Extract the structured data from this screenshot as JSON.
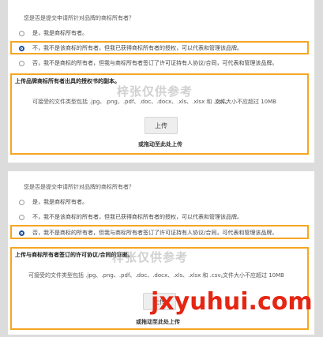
{
  "panel1": {
    "question": "您是否是提交申请所针对品牌的商标所有者？",
    "options": [
      "是，我是商标所有者。",
      "不，我不是该商标的所有者，但我已获得商标所有者的授权，可以代表和管理该品牌。",
      "否，我不是商标的所有者，但我与商标所有者签订了许可证持有人协议/合同，可代表和管理该品牌。"
    ],
    "selected_index": 1,
    "upload_title": "上传品牌商标所有者出具的授权书的副本。",
    "accept_text": "可接受的文件类型包括 .jpg、.png、.pdf、.doc、.docx、.xls、.xlsx 和 .csv。",
    "max_size": "文件大小不应超过 10MB",
    "upload_button": "上传",
    "drop_text": "或拖动至此处上传",
    "watermark": "梓张仅供参考"
  },
  "panel2": {
    "question": "您是否是提交申请所针对品牌的商标所有者？",
    "options": [
      "是，我是商标所有者。",
      "不，我不是该商标的所有者，但我已获得商标所有者的授权，可以代表和管理该品牌。",
      "否，我不是商标的所有者，但我与商标所有者签订了许可证持有人协议/合同，可代表和管理该品牌。"
    ],
    "selected_index": 2,
    "upload_title": "上传与商标所有者签订的许可协议/合同的证据。",
    "accept_text": "可接受的文件类型包括 .jpg、.png、.pdf、.doc、.docx、.xls、.xlsx 和 .csv。",
    "max_size": "文件大小不应超过 10MB",
    "upload_button": "上传",
    "drop_text": "或拖动至此处上传",
    "watermark": "梓张仅供参考"
  },
  "site_watermark": "jxyuhui.com"
}
